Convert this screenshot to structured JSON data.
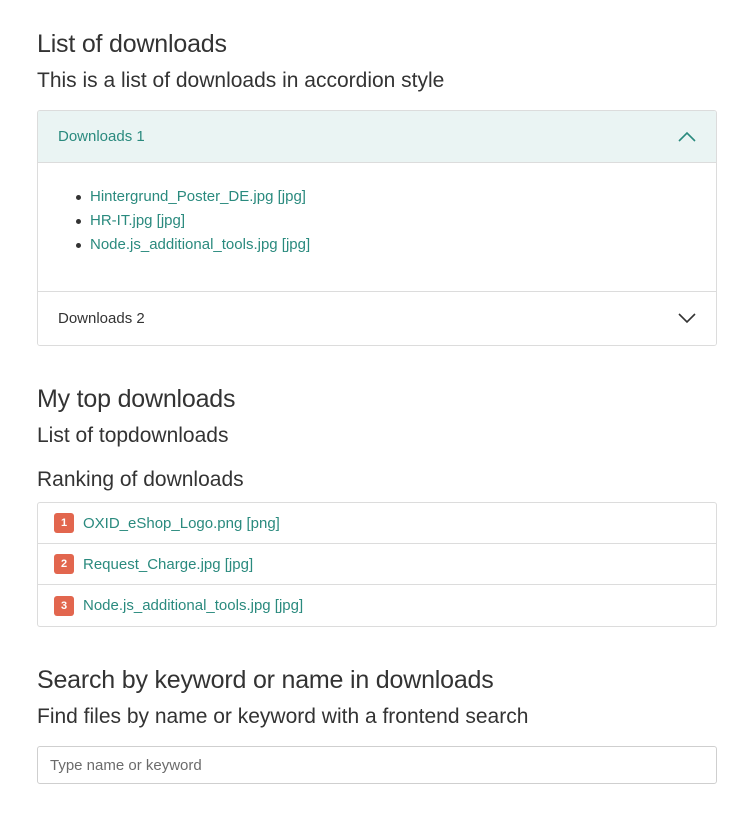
{
  "section_downloads": {
    "title": "List of downloads",
    "subtitle": "This is a list of downloads in accordion style",
    "accordion": [
      {
        "label": "Downloads 1",
        "state": "open",
        "files": [
          "Hintergrund_Poster_DE.jpg [jpg]",
          "HR-IT.jpg [jpg]",
          "Node.js_additional_tools.jpg [jpg]"
        ]
      },
      {
        "label": "Downloads 2",
        "state": "closed",
        "files": []
      }
    ]
  },
  "section_top": {
    "title": "My top downloads",
    "subtitle": "List of topdownloads",
    "ranking_heading": "Ranking of downloads",
    "ranking": [
      {
        "rank": "1",
        "file": "OXID_eShop_Logo.png [png]"
      },
      {
        "rank": "2",
        "file": "Request_Charge.jpg [jpg]"
      },
      {
        "rank": "3",
        "file": "Node.js_additional_tools.jpg [jpg]"
      }
    ]
  },
  "section_search": {
    "title": "Search by keyword or name in downloads",
    "subtitle": "Find files by name or keyword with a frontend search",
    "placeholder": "Type name or keyword",
    "value": ""
  },
  "colors": {
    "accent": "#2a8a7e",
    "accordion_open_bg": "#eaf4f3",
    "badge": "#e2664e",
    "border": "#dcdcdc"
  },
  "icons": {
    "collapse": "chevron-up-icon",
    "expand": "chevron-down-icon"
  }
}
